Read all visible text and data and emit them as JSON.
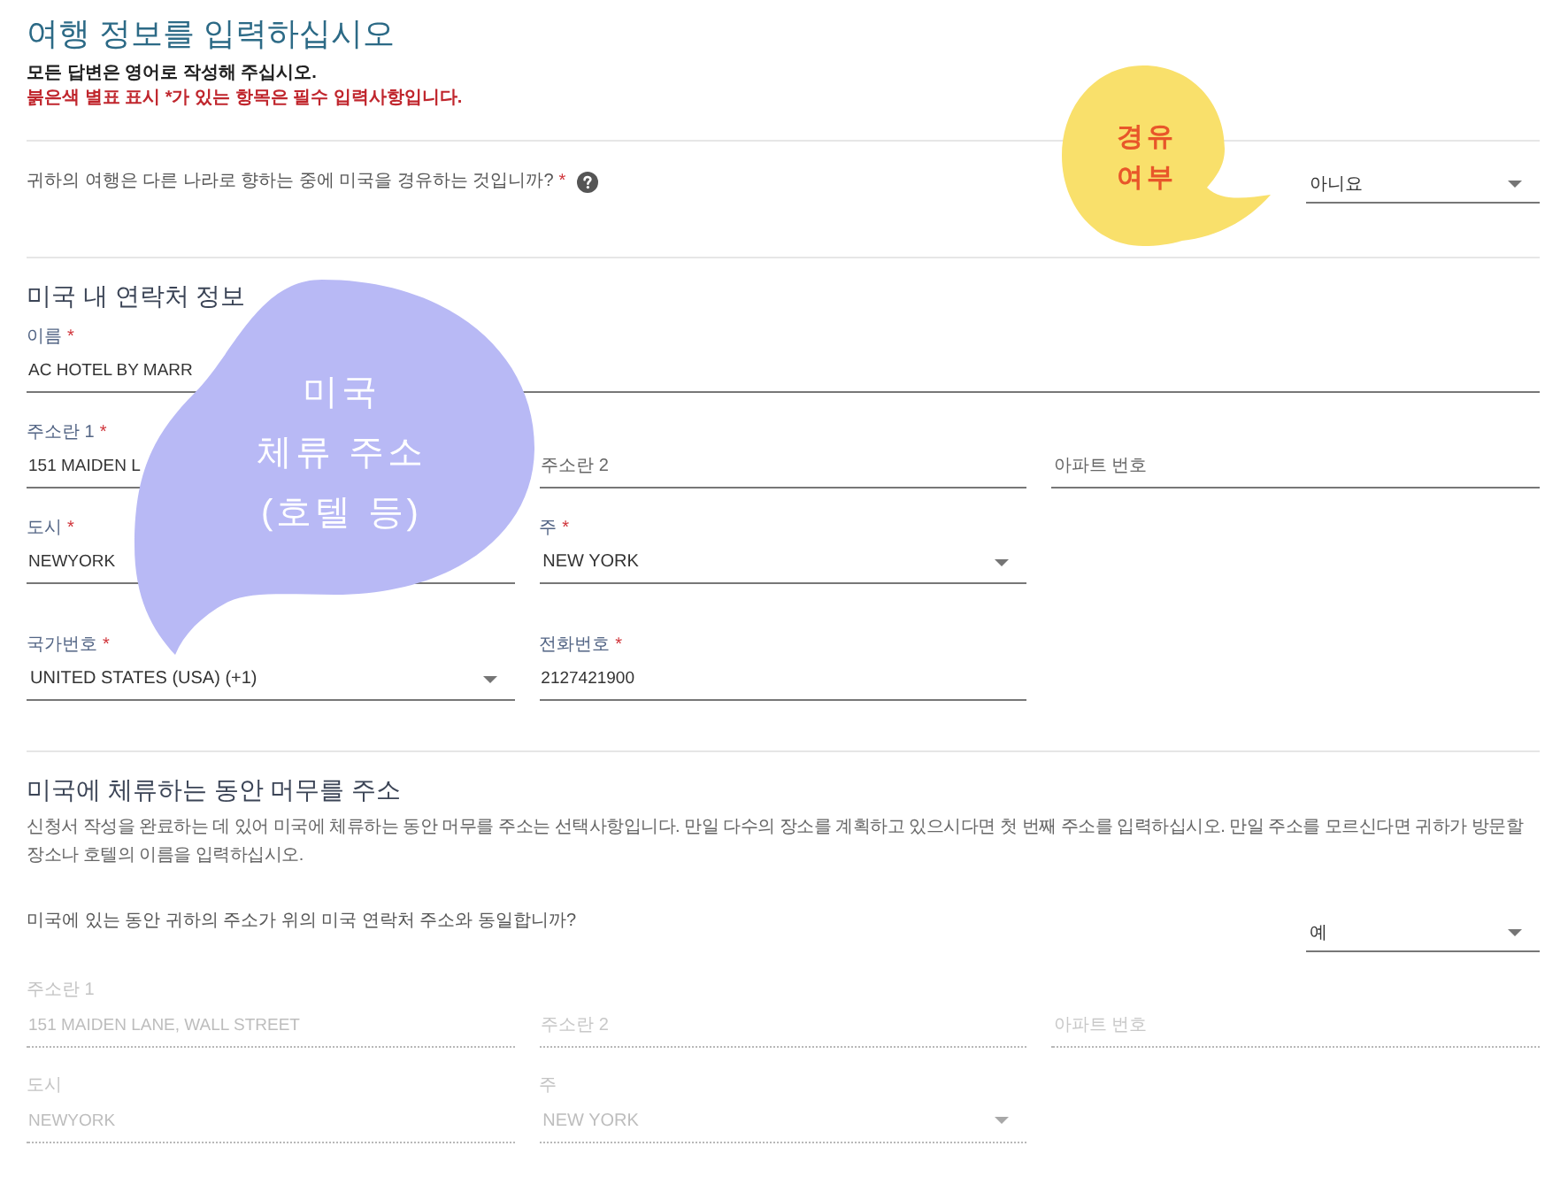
{
  "header": {
    "title": "여행 정보를 입력하십시오",
    "notes": [
      {
        "kind": "info",
        "text": "모든 답변은 영어로 작성해 주십시오."
      },
      {
        "kind": "warning",
        "text": "붉은색 별표 표시 *가 있는 항목은 필수 입력사항입니다."
      }
    ]
  },
  "transit_question": {
    "text": "귀하의 여행은 다른 나라로 향하는 중에 미국을 경유하는 것입니까?",
    "asterisk": "*",
    "help": true,
    "answer": {
      "kind": "select",
      "value": "아니요",
      "disabled": false
    }
  },
  "contact_section": {
    "heading": "미국 내 연락처 정보",
    "rows": [
      [
        {
          "kind": "text",
          "label": "이름",
          "asterisk": "*",
          "value": "AC HOTEL BY MARR",
          "disabled": false
        }
      ],
      [
        {
          "kind": "text",
          "label": "주소란 1",
          "asterisk": "*",
          "value": "151 MAIDEN L",
          "disabled": false
        },
        {
          "kind": "text",
          "placeholder": "주소란 2",
          "disabled": false
        },
        {
          "kind": "text",
          "placeholder": "아파트 번호",
          "disabled": false
        }
      ],
      [
        {
          "kind": "text",
          "label": "도시",
          "asterisk": "*",
          "value": "NEWYORK",
          "disabled": false
        },
        {
          "kind": "select",
          "label": "주",
          "asterisk": "*",
          "value": "NEW YORK",
          "disabled": false
        }
      ],
      [
        {
          "kind": "select",
          "label": "국가번호",
          "asterisk": "*",
          "value": "UNITED STATES (USA) (+1)",
          "disabled": false
        },
        {
          "kind": "text",
          "label": "전화번호",
          "asterisk": "*",
          "value": "2127421900",
          "disabled": false
        }
      ]
    ]
  },
  "stay_section": {
    "heading": "미국에 체류하는 동안 머무를 주소",
    "description": "신청서 작성을 완료하는 데 있어 미국에 체류하는 동안 머무를 주소는 선택사항입니다. 만일 다수의 장소를 계획하고 있으시다면 첫 번째 주소를 입력하십시오. 만일 주소를 모르신다면 귀하가 방문할 장소나 호텔의 이름을 입력하십시오.",
    "question": {
      "text": "미국에 있는 동안 귀하의 주소가 위의 미국 연락처 주소와 동일합니까?",
      "answer": {
        "kind": "select",
        "value": "예",
        "disabled": false
      }
    },
    "rows": [
      [
        {
          "kind": "text",
          "label": "주소란 1",
          "value": "151 MAIDEN LANE, WALL STREET",
          "disabled": true
        },
        {
          "kind": "text",
          "placeholder": "주소란 2",
          "disabled": true
        },
        {
          "kind": "text",
          "placeholder": "아파트 번호",
          "disabled": true
        }
      ],
      [
        {
          "kind": "text",
          "label": "도시",
          "value": "NEWYORK",
          "disabled": true
        },
        {
          "kind": "select",
          "label": "주",
          "value": "NEW YORK",
          "disabled": true
        }
      ]
    ]
  },
  "callouts": [
    {
      "kind": "tail-right",
      "color": "#f9e06b",
      "lines": [
        "경유",
        "여부"
      ]
    },
    {
      "kind": "tail-down",
      "color": "#b8b9f5",
      "lines": [
        "미국",
        "체류 주소",
        "(호텔 등)"
      ]
    }
  ]
}
